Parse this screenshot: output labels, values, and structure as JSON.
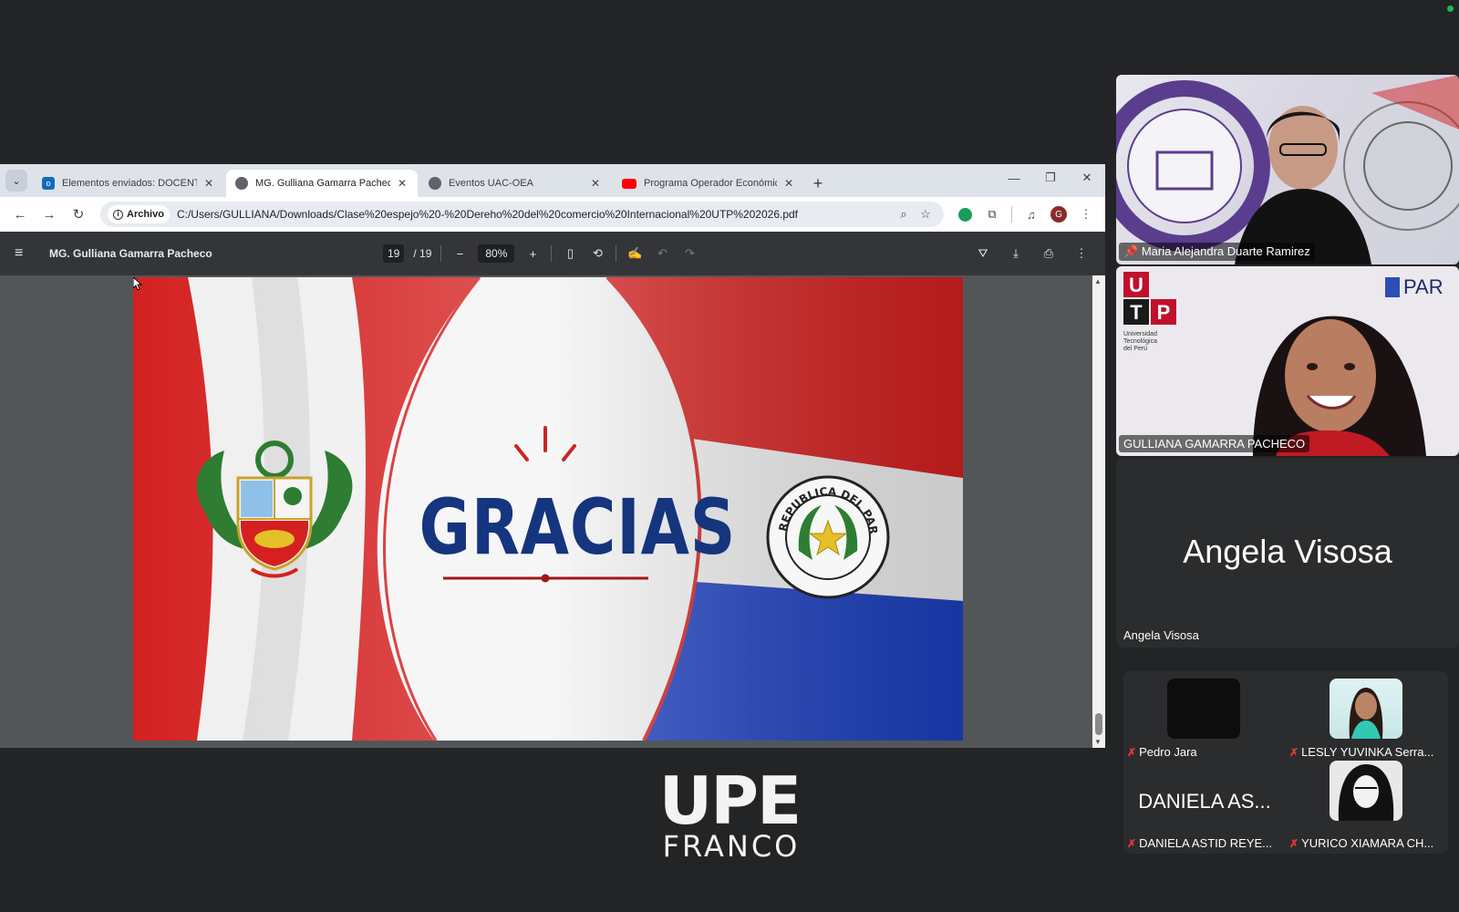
{
  "browser": {
    "tabs": [
      {
        "title": "Elementos enviados: DOCENTE",
        "icon": "outlook-icon",
        "active": false
      },
      {
        "title": "MG. Gulliana Gamarra Pacheco",
        "icon": "globe-icon",
        "active": true
      },
      {
        "title": "Eventos UAC-OEA",
        "icon": "globe-icon",
        "active": false
      },
      {
        "title": "Programa Operador Económico",
        "icon": "youtube-icon",
        "active": false
      }
    ],
    "site_chip": "Archivo",
    "url": "C:/Users/GULLIANA/Downloads/Clase%20espejo%20-%20Dereho%20del%20comercio%20Internacional%20UTP%202026.pdf",
    "profile_initial": "G"
  },
  "pdf": {
    "title": "MG. Gulliana Gamarra Pacheco",
    "current_page": "19",
    "total_pages": "/ 19",
    "zoom": "80%"
  },
  "slide": {
    "headline": "GRACIAS",
    "seal_text": "REPUBLICA DEL PARAGUAY",
    "colors": {
      "red": "#d42020",
      "white": "#f2f2f2",
      "blue": "#1c3fbf",
      "navy": "#15357f"
    }
  },
  "logo": {
    "line1": "UPE",
    "line2": "FRANCO"
  },
  "meeting": {
    "participants_large": [
      {
        "name": "Maria Alejandra Duarte Ramirez",
        "pinned": true
      },
      {
        "name": "GULLIANA GAMARRA PACHECO",
        "pinned": false
      },
      {
        "name": "Angela Visosa",
        "display": "Angela Visosa",
        "pinned": false
      }
    ],
    "tile_logos": {
      "utp": "UTP",
      "utp_sub": "Universidad Tecnológica del Perú",
      "par": "PAR"
    },
    "participants_small": [
      {
        "name": "Pedro Jara",
        "muted": true
      },
      {
        "name": "LESLY YUVINKA Serra...",
        "muted": true
      },
      {
        "name": "DANIELA ASTID REYE...",
        "initials": "DANIELA AS...",
        "muted": true
      },
      {
        "name": "YURICO XIAMARA CH...",
        "muted": true
      }
    ]
  }
}
